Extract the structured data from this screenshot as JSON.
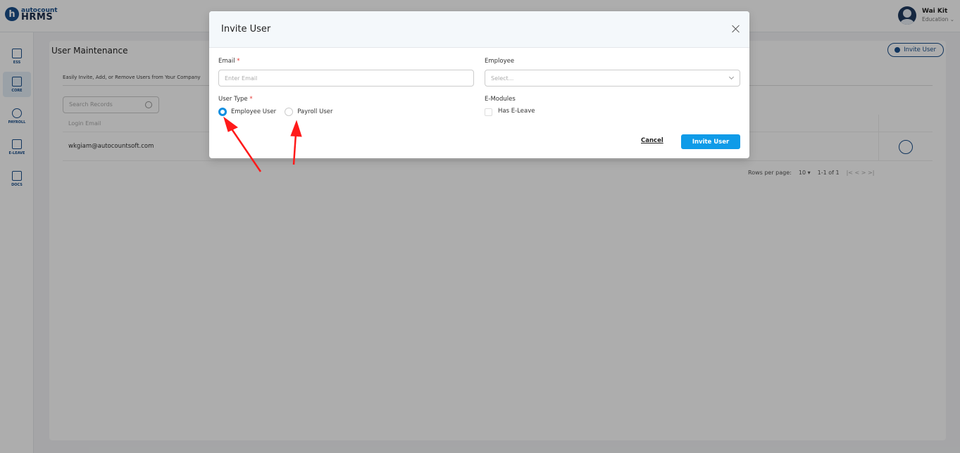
{
  "app": {
    "logo_top": "autocount",
    "logo_bottom": "HRMS",
    "user_name": "Wai Kit",
    "user_org": "Education"
  },
  "sidebar": {
    "items": [
      {
        "label": "ESS",
        "icon": "ess-icon"
      },
      {
        "label": "CORE",
        "icon": "core-cube-icon",
        "active": true
      },
      {
        "label": "PAYROLL",
        "icon": "dollar-icon"
      },
      {
        "label": "E-LEAVE",
        "icon": "calendar-icon"
      },
      {
        "label": "DOCS",
        "icon": "docs-icon"
      }
    ]
  },
  "page": {
    "title": "User Maintenance",
    "invite_button": "Invite User",
    "subtitle": "Easily Invite, Add, or Remove Users from Your Company",
    "search_placeholder": "Search Records",
    "table": {
      "headers": [
        "Login Email"
      ],
      "rows": [
        {
          "email": "wkgiam@autocountsoft.com"
        }
      ]
    },
    "pagination": {
      "rows_per_page_label": "Rows per page:",
      "rows_per_page": "10 ▾",
      "range": "1-1 of 1",
      "nav": "|<   <   >   >|"
    }
  },
  "modal": {
    "title": "Invite User",
    "email_label": "Email",
    "email_placeholder": "Enter Email",
    "employee_label": "Employee",
    "employee_placeholder": "Select...",
    "user_type_label": "User Type",
    "user_types": [
      {
        "label": "Employee User",
        "checked": true
      },
      {
        "label": "Payroll User",
        "checked": false
      }
    ],
    "emodules_label": "E-Modules",
    "has_eleave_label": "Has E-Leave",
    "cancel_label": "Cancel",
    "invite_label": "Invite User",
    "required_mark": "*"
  },
  "colors": {
    "primary": "#1a4f8b",
    "accent": "#0f9be8",
    "arrow": "#ff1a1a"
  }
}
